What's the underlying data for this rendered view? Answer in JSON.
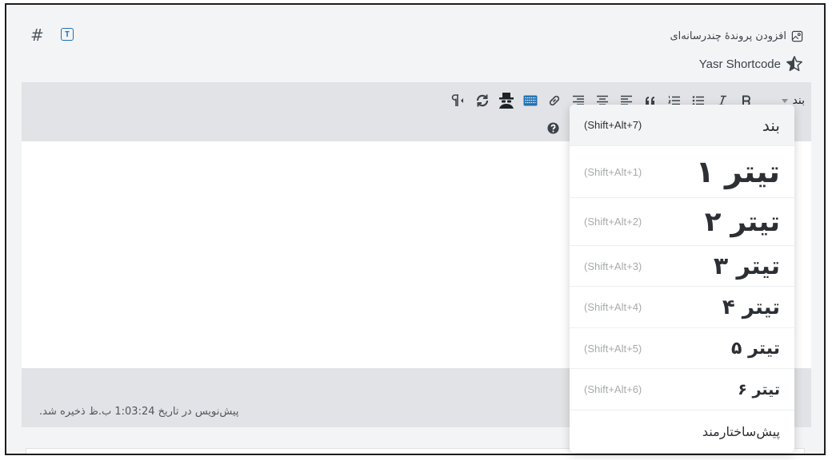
{
  "topbar": {
    "add_media_label": "افزودن پروندهٔ چندرسانه‌ای",
    "shortcode_label": "Yasr Shortcode",
    "hash_icon": "#",
    "text_button_label": "T"
  },
  "toolbar": {
    "format_select_value": "بند"
  },
  "status": {
    "autosave_text": "پیش‌نویس در تاریخ 1:03:24 ب.ظ ذخیره شد."
  },
  "format_menu": {
    "items": [
      {
        "label": "بند",
        "shortcut": "(Shift+Alt+7)"
      },
      {
        "label": "تیتر ۱",
        "shortcut": "(Shift+Alt+1)"
      },
      {
        "label": "تیتر ۲",
        "shortcut": "(Shift+Alt+2)"
      },
      {
        "label": "تیتر ۳",
        "shortcut": "(Shift+Alt+3)"
      },
      {
        "label": "تیتر ۴",
        "shortcut": "(Shift+Alt+4)"
      },
      {
        "label": "تیتر ۵",
        "shortcut": "(Shift+Alt+5)"
      },
      {
        "label": "تیتر ۶",
        "shortcut": "(Shift+Alt+6)"
      },
      {
        "label": "پیش‌ساختارمند",
        "shortcut": ""
      }
    ]
  },
  "colors": {
    "accent": "#2271b1",
    "toolbar_bg": "#e2e3e6",
    "page_bg": "#f3f4f6"
  }
}
